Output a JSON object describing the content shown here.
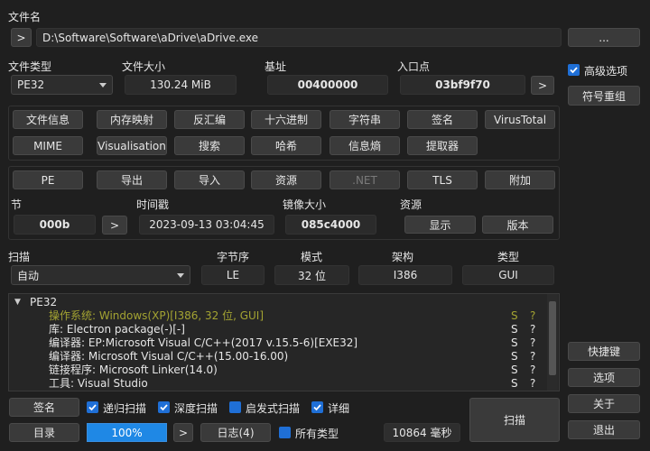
{
  "file": {
    "label": "文件名",
    "expand_button": ">",
    "path": "D:\\Software\\Software\\aDrive\\aDrive.exe",
    "browse_button": "..."
  },
  "file_type": {
    "label": "文件类型",
    "value": "PE32"
  },
  "file_size": {
    "label": "文件大小",
    "value": "130.24 MiB"
  },
  "base_address": {
    "label": "基址",
    "value": "00400000"
  },
  "entry_point": {
    "label": "入口点",
    "value": "03bf9f70",
    "button": ">"
  },
  "advanced": {
    "label": "高级选项",
    "checked": true
  },
  "symbol_button": "符号重组",
  "tools_row1": [
    "文件信息",
    "内存映射",
    "反汇编",
    "十六进制",
    "字符串",
    "签名",
    "VirusTotal"
  ],
  "tools_row2": [
    "MIME",
    "Visualisation",
    "搜索",
    "哈希",
    "信息熵",
    "提取器"
  ],
  "pe_row": [
    "PE",
    "导出",
    "导入",
    "资源",
    ".NET",
    "TLS",
    "附加"
  ],
  "sections": {
    "label": "节",
    "value": "000b",
    "button": ">"
  },
  "timestamp": {
    "label": "时间戳",
    "value": "2023-09-13 03:04:45"
  },
  "image_size": {
    "label": "镜像大小",
    "value": "085c4000"
  },
  "resources": {
    "label": "资源",
    "show_button": "显示",
    "version_button": "版本"
  },
  "scan": {
    "label": "扫描",
    "mode": "自动"
  },
  "endianness": {
    "label": "字节序",
    "value": "LE"
  },
  "mode": {
    "label": "模式",
    "value": "32 位"
  },
  "arch": {
    "label": "架构",
    "value": "I386"
  },
  "type": {
    "label": "类型",
    "value": "GUI"
  },
  "results": {
    "root": "PE32",
    "root_toggle": "▼",
    "rows": [
      {
        "text": "操作系统: Windows(XP)[I386, 32 位, GUI]",
        "s": "S",
        "q": "?",
        "color": "#a3a332"
      },
      {
        "text": "库: Electron package(-)[-]",
        "s": "S",
        "q": "?",
        "color": "#e6e6e6"
      },
      {
        "text": "编译器: EP:Microsoft Visual C/C++(2017 v.15.5-6)[EXE32]",
        "s": "S",
        "q": "?",
        "color": "#e6e6e6"
      },
      {
        "text": "编译器: Microsoft Visual C/C++(15.00-16.00)",
        "s": "S",
        "q": "?",
        "color": "#e6e6e6"
      },
      {
        "text": "链接程序: Microsoft Linker(14.0)",
        "s": "S",
        "q": "?",
        "color": "#e6e6e6"
      },
      {
        "text": "工具: Visual Studio",
        "s": "S",
        "q": "?",
        "color": "#e6e6e6"
      }
    ]
  },
  "bottom": {
    "signature_button": "签名",
    "recursive": "递归扫描",
    "deep": "深度扫描",
    "heuristic": "启发式扫描",
    "verbose": "详细",
    "dir_button": "目录",
    "progress": "100%",
    "progress_arrow": ">",
    "log_button": "日志(4)",
    "all_types": "所有类型",
    "elapsed": "10864 毫秒",
    "scan_button": "扫描"
  },
  "side": {
    "shortcuts": "快捷键",
    "options": "选项",
    "about": "关于",
    "exit": "退出"
  },
  "colors": {
    "accent": "#1f6fd6",
    "progress": "#1f88e5",
    "os_line": "#a3a332"
  }
}
